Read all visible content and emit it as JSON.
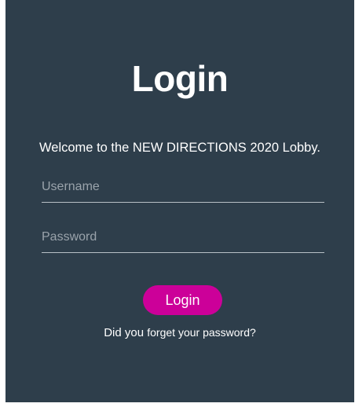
{
  "login_form": {
    "title": "Login",
    "welcome": "Welcome to the NEW DIRECTIONS 2020 Lobby.",
    "username": {
      "placeholder": "Username",
      "value": ""
    },
    "password": {
      "placeholder": "Password",
      "value": ""
    },
    "submit_label": "Login",
    "forgot_prefix": "Did you ",
    "forgot_link": "forget your password?"
  },
  "colors": {
    "background": "#2e3e4b",
    "accent": "#cc0099",
    "text": "#ffffff"
  }
}
